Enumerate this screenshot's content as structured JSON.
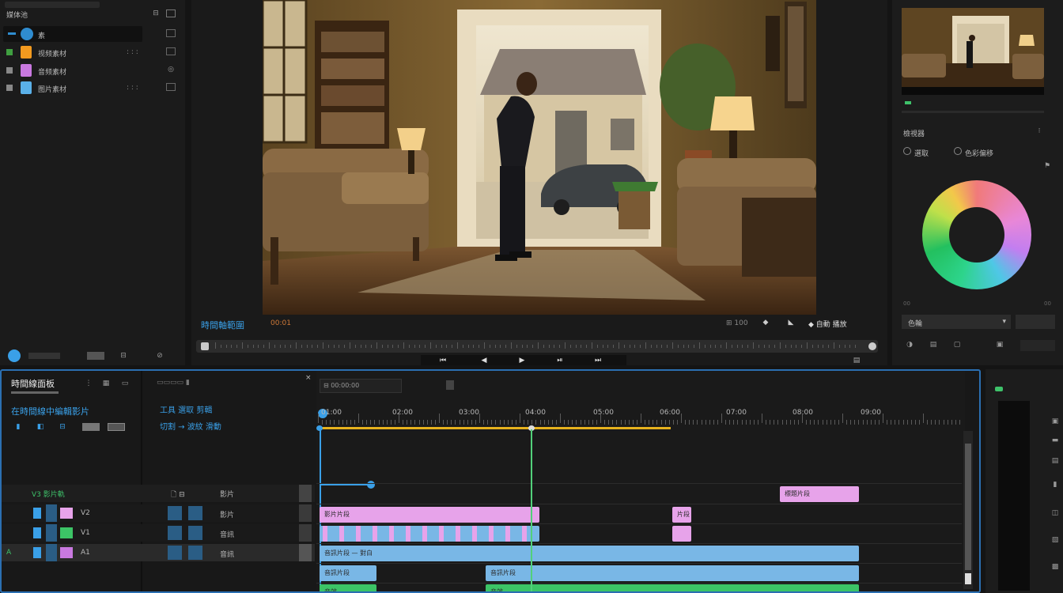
{
  "project": {
    "title": "媒体池",
    "bins": [
      {
        "label": "素",
        "color": "#2f8ccf"
      },
      {
        "label": "视频素材",
        "color": "#f29a1f"
      },
      {
        "label": "音频素材",
        "color": "#c979e0"
      },
      {
        "label": "图片素材",
        "color": "#5ab0e8"
      }
    ]
  },
  "viewer": {
    "timecode_left": "時間軸範圍",
    "timecode_center": "00:01",
    "controls_right": "◆ 自動 播放",
    "transport": [
      "⏮",
      "◀",
      "▶",
      "⏯",
      "⏭"
    ]
  },
  "inspector": {
    "section1": "檢視器",
    "opt1": "選取",
    "opt2": "色彩偏移",
    "color_wheel_label": "色輪"
  },
  "timeline": {
    "title": "時間線面板",
    "subtitle": "在時間線中編輯影片",
    "tools_label": "工具 選取 剪輯",
    "tools_row2": "切割 → 波紋 滑動",
    "ruler_labels": [
      "01:00",
      "02:00",
      "03:00",
      "04:00",
      "05:00",
      "06:00",
      "07:00",
      "08:00",
      "09:00"
    ],
    "tracks": [
      {
        "name": "V3 影片軌",
        "label": "影片"
      },
      {
        "name": "V2",
        "label": "影片"
      },
      {
        "name": "V1",
        "label": "音訊"
      },
      {
        "name": "A1",
        "label": "音訊"
      }
    ],
    "clip_labels": {
      "title_clip": "標題片段",
      "pink_clip": "影片片段",
      "pink_clip2": "片段",
      "blue_clip": "音訊片段 — 對白",
      "blue_clip2": "音訊片段",
      "green_clip": "音效"
    }
  },
  "colors": {
    "accent_blue": "#2b6fb2",
    "playhead_green": "#52d07a",
    "yellow_range": "#e6b21e"
  }
}
